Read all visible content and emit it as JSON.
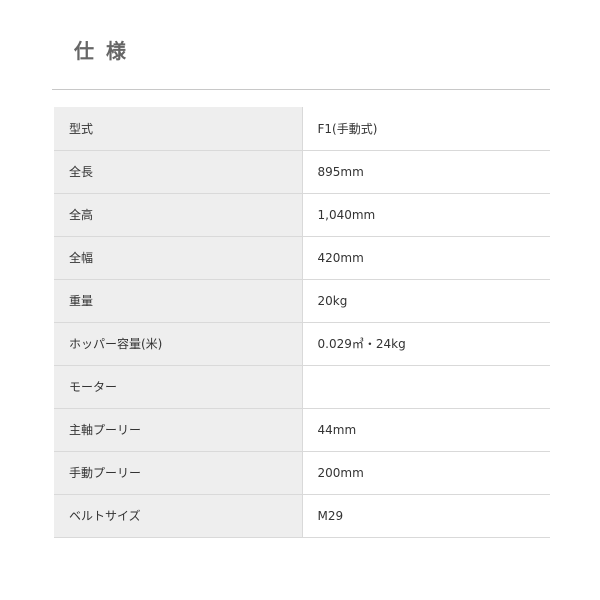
{
  "title": "仕様",
  "spec_rows": [
    {
      "label": "型式",
      "value": "F1(手動式)"
    },
    {
      "label": "全長",
      "value": "895mm"
    },
    {
      "label": "全高",
      "value": "1,040mm"
    },
    {
      "label": "全幅",
      "value": "420mm"
    },
    {
      "label": "重量",
      "value": "20kg"
    },
    {
      "label": "ホッパー容量(米)",
      "value": "0.029㎥・24kg"
    },
    {
      "label": "モーター",
      "value": ""
    },
    {
      "label": "主軸プーリー",
      "value": "44mm"
    },
    {
      "label": "手動プーリー",
      "value": "200mm"
    },
    {
      "label": "ベルトサイズ",
      "value": "M29"
    }
  ]
}
